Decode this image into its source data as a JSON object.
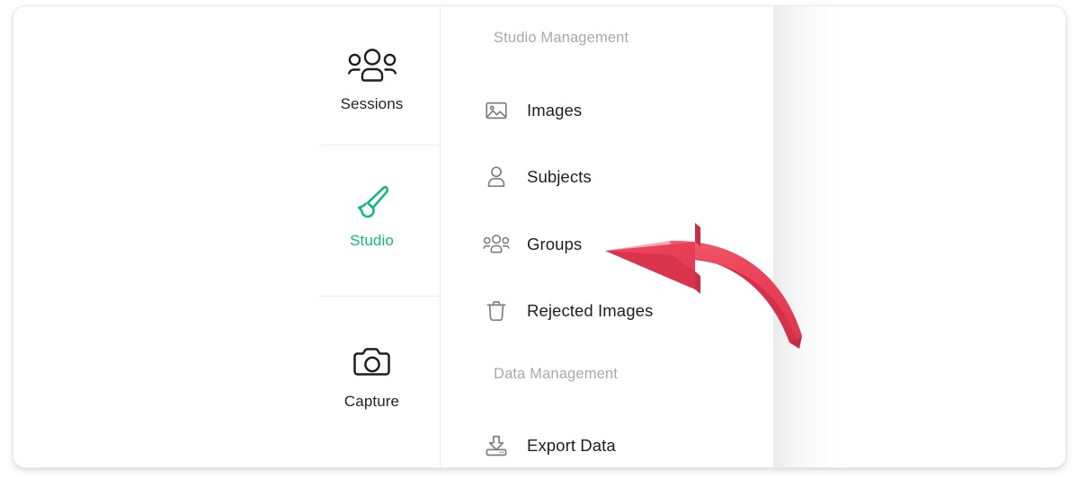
{
  "theme": {
    "accent_teal": "#13b884",
    "text_primary": "#1d1e21",
    "text_muted": "#a7a9ae",
    "divider": "#ededef",
    "icon_stroke": "#7d7f85",
    "arrow_red": "#ee4055",
    "arrow_red_dark": "#d8304a",
    "card_background": "#ffffff"
  },
  "icon_rail": {
    "items": [
      {
        "id": "sessions",
        "label": "Sessions",
        "icon": "people-group-icon",
        "active": false
      },
      {
        "id": "studio",
        "label": "Studio",
        "icon": "paintbrush-icon",
        "active": true
      },
      {
        "id": "capture",
        "label": "Capture",
        "icon": "camera-icon",
        "active": false
      }
    ]
  },
  "menu_panel": {
    "sections": [
      {
        "id": "studio-management",
        "title": "Studio Management",
        "items": [
          {
            "id": "images",
            "label": "Images",
            "icon": "image-icon"
          },
          {
            "id": "subjects",
            "label": "Subjects",
            "icon": "person-icon"
          },
          {
            "id": "groups",
            "label": "Groups",
            "icon": "people-group-icon"
          },
          {
            "id": "rejected-images",
            "label": "Rejected Images",
            "icon": "trash-icon"
          }
        ]
      },
      {
        "id": "data-management",
        "title": "Data Management",
        "items": [
          {
            "id": "export-data",
            "label": "Export Data",
            "icon": "download-tray-icon"
          }
        ]
      }
    ]
  },
  "annotation": {
    "type": "curved-arrow",
    "color": "#ee4055",
    "points_to": "Groups",
    "direction": "left"
  }
}
